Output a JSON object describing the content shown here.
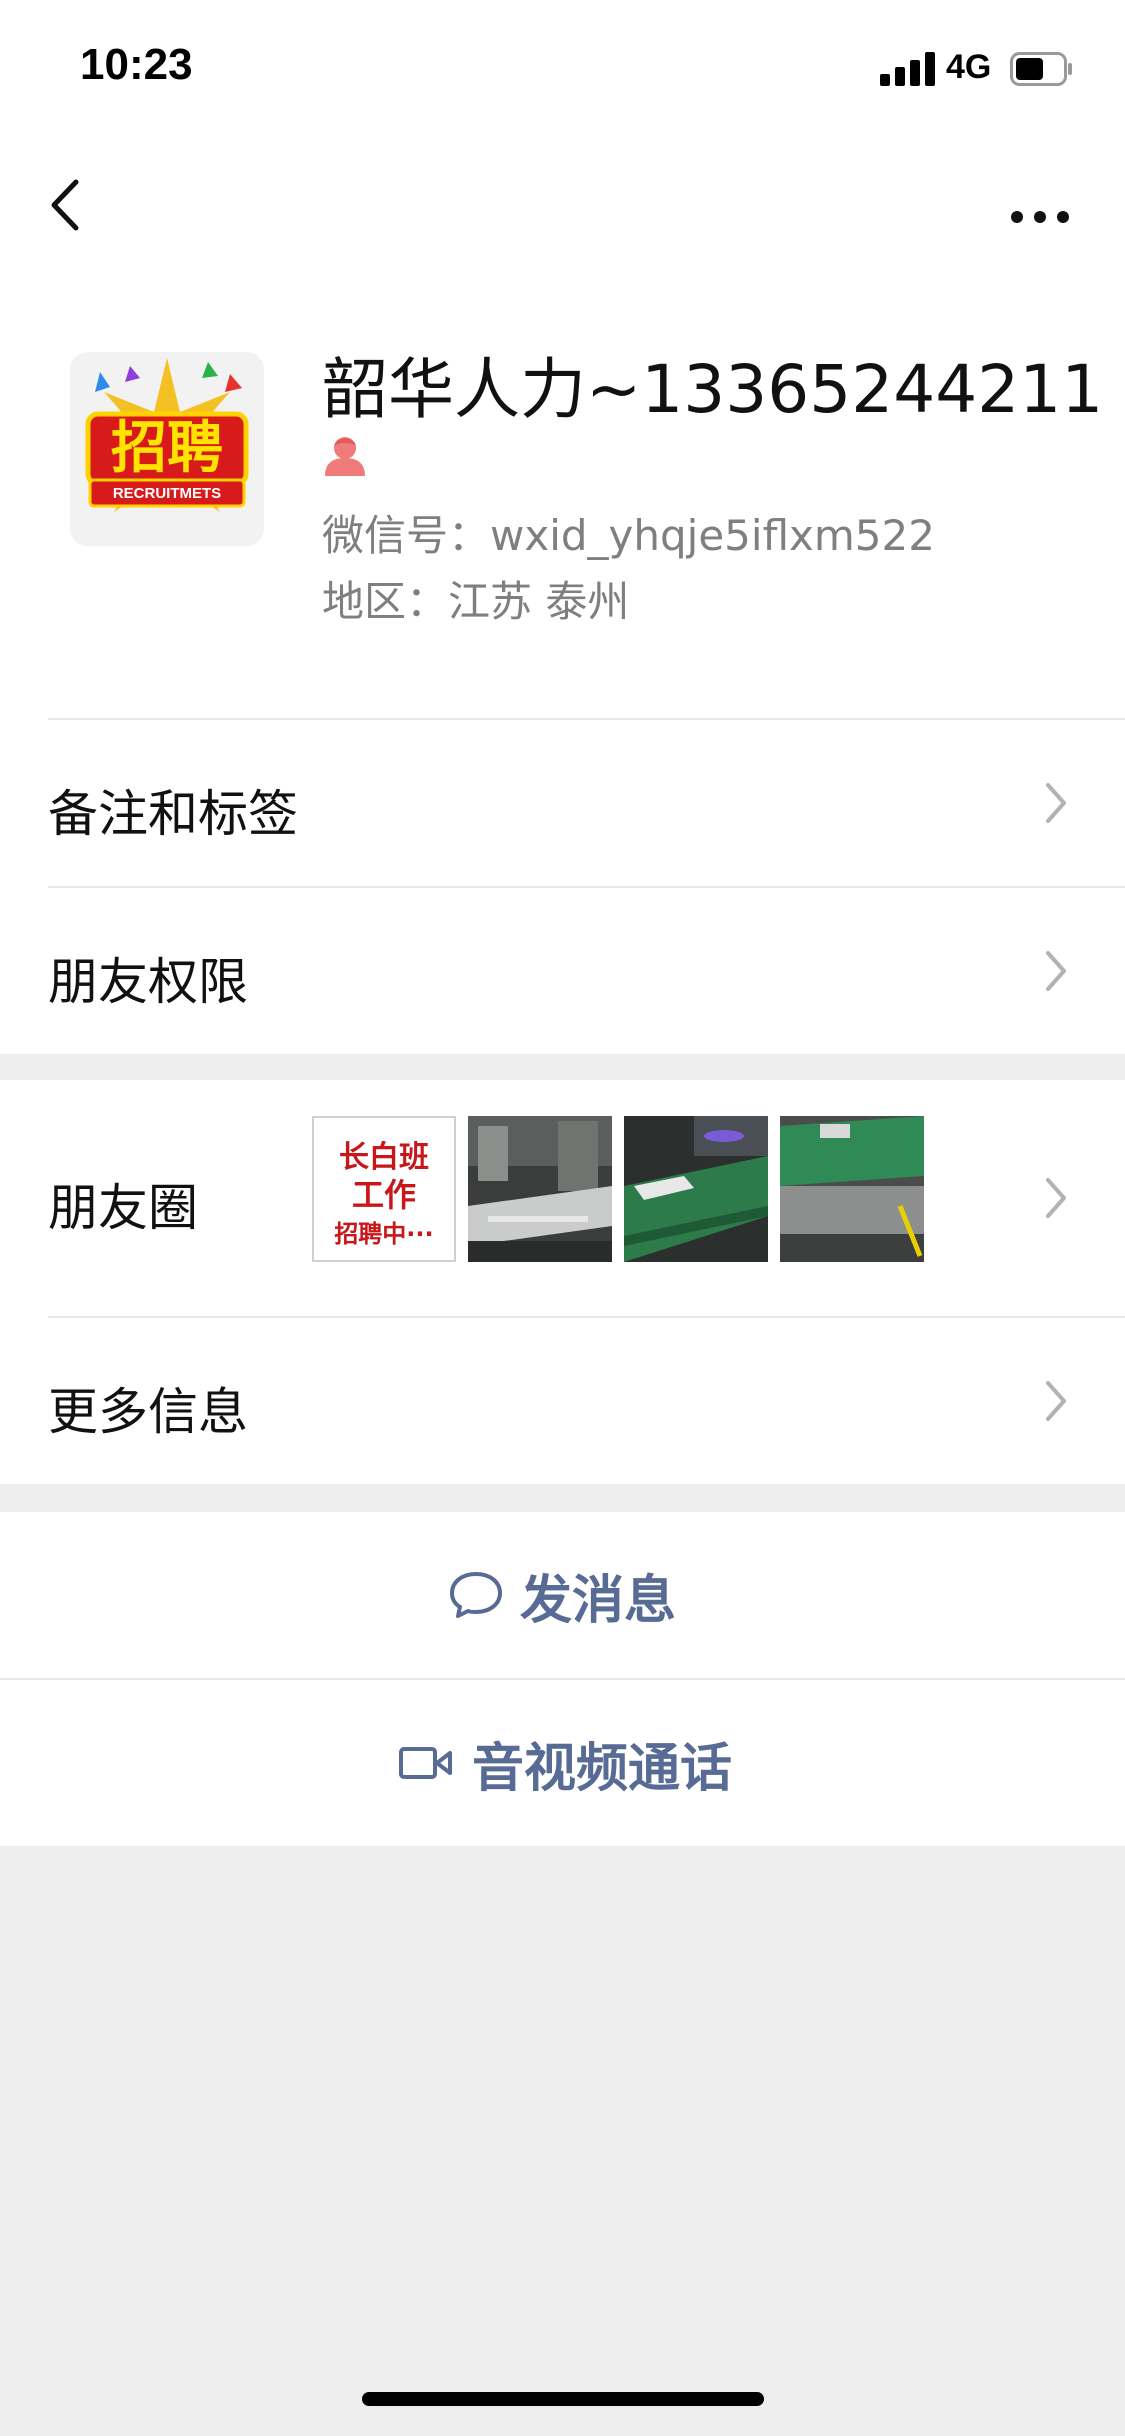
{
  "status_bar": {
    "time": "10:23",
    "network": "4G",
    "battery_level": 0.6
  },
  "nav": {
    "back_icon": "chevron-left-icon",
    "more_icon": "more-dots-icon"
  },
  "profile": {
    "name": "韶华人力~13365244211",
    "avatar_text": "招聘",
    "avatar_subtext": "RECRUITMETS",
    "wechat_id": "微信号：wxid_yhqje5iflxm522",
    "region": "地区：江苏 泰州",
    "gender_icon": "female-icon"
  },
  "settings": {
    "remarks_label": "备注和标签",
    "permissions_label": "朋友权限"
  },
  "moments": {
    "label": "朋友圈",
    "thumbnail_1_lines": [
      "长白班",
      "工作",
      "招聘中···"
    ]
  },
  "more_info": {
    "label": "更多信息"
  },
  "actions": {
    "message_label": "发消息",
    "call_label": "音视频通话"
  },
  "colors": {
    "link_blue": "#576b95",
    "background_gray": "#ededed",
    "secondary_text": "#7f7f7f",
    "poster_red": "#c8171b"
  }
}
